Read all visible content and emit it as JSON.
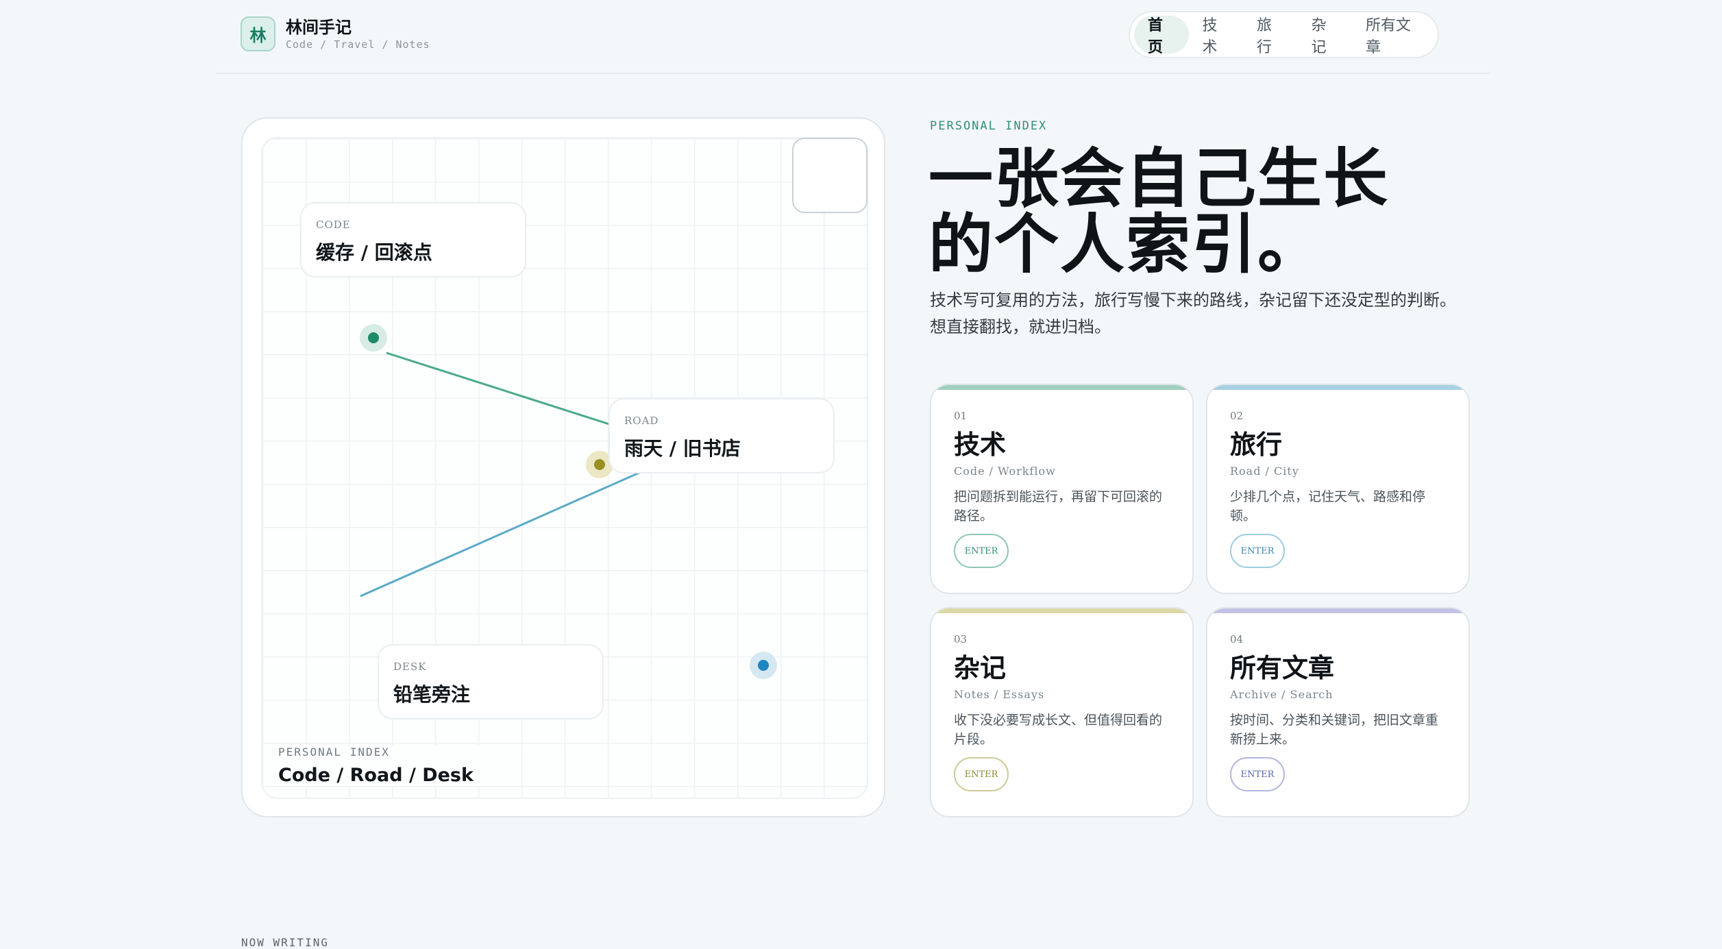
{
  "brand": {
    "badge": "林",
    "title": "林间手记",
    "subtitle": "Code / Travel / Notes"
  },
  "nav": {
    "items": [
      {
        "label": "首页",
        "active": true
      },
      {
        "label": "技术",
        "active": false
      },
      {
        "label": "旅行",
        "active": false
      },
      {
        "label": "杂记",
        "active": false
      },
      {
        "label": "所有文章",
        "active": false
      }
    ]
  },
  "map": {
    "cards": [
      {
        "kicker": "CODE",
        "title": "缓存 / 回滚点"
      },
      {
        "kicker": "ROAD",
        "title": "雨天 / 旧书店"
      },
      {
        "kicker": "DESK",
        "title": "铅笔旁注"
      }
    ],
    "footer": {
      "kicker": "PERSONAL INDEX",
      "title": "Code / Road / Desk"
    },
    "colors": {
      "code": "#1e8a6a",
      "road": "#9a8f22",
      "desk": "#1f86c1",
      "line_green": "#4aaa88",
      "line_blue": "#5aaac8"
    }
  },
  "hero": {
    "eyebrow": "PERSONAL INDEX",
    "title_line1": "一张会自己生长",
    "title_line2": "的个人索引。",
    "desc_line1": "技术写可复用的方法，旅行写慢下来的路线，杂记留下还没定型的判断。",
    "desc_line2": "想直接翻找，就进归档。"
  },
  "categories": [
    {
      "num": "01",
      "title": "技术",
      "sub": "Code / Workflow",
      "desc": "把问题拆到能运行，再留下可回滚的路径。",
      "button": "ENTER",
      "accent": "#9fcfbf",
      "btn_color": "#2f8f77"
    },
    {
      "num": "02",
      "title": "旅行",
      "sub": "Road / City",
      "desc": "少排几个点，记住天气、路感和停顿。",
      "button": "ENTER",
      "accent": "#a8d0e2",
      "btn_color": "#3b86ad"
    },
    {
      "num": "03",
      "title": "杂记",
      "sub": "Notes / Essays",
      "desc": "收下没必要写成长文、但值得回看的片段。",
      "button": "ENTER",
      "accent": "#dcd7a6",
      "btn_color": "#8a8a2e"
    },
    {
      "num": "04",
      "title": "所有文章",
      "sub": "Archive / Search",
      "desc": "按时间、分类和关键词，把旧文章重新捞上来。",
      "button": "ENTER",
      "accent": "#c2c3e4",
      "btn_color": "#5b66a8"
    }
  ],
  "now_writing": "NOW WRITING"
}
